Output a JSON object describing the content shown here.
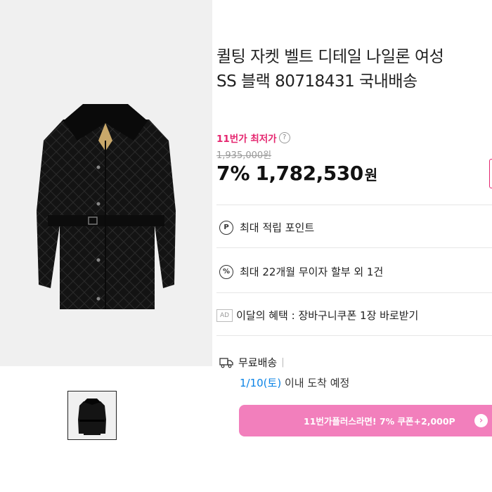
{
  "product": {
    "title_line1": "퀼팅 자켓 벨트 디테일 나일론 여성",
    "title_line2": "SS 블랙 80718431 국내배송"
  },
  "price": {
    "lowest_label": "11번가 최저가",
    "help_glyph": "?",
    "original": "1,935,000원",
    "discount": "7%",
    "sale": "1,782,530",
    "currency": "원"
  },
  "benefits": {
    "points_icon": "P",
    "points_label": "최대 적립 포인트",
    "installment_icon": "%",
    "installment_label": "최대 22개월 무이자 할부 외 1건",
    "ad_badge": "AD",
    "coupon_label": "이달의 혜택 : 장바구니쿠폰 1장 바로받기"
  },
  "shipping": {
    "label": "무료배송",
    "separator": "|",
    "arrival_date": "1/10(토)",
    "arrival_suffix": " 이내 도착 예정"
  },
  "plus_banner": {
    "text": "11번가플러스라면! 7% 쿠폰+2,000P",
    "arrow": "›"
  },
  "colors": {
    "accent_pink": "#e5266f",
    "banner_pink": "#f27fbc",
    "date_blue": "#0b83e6"
  }
}
